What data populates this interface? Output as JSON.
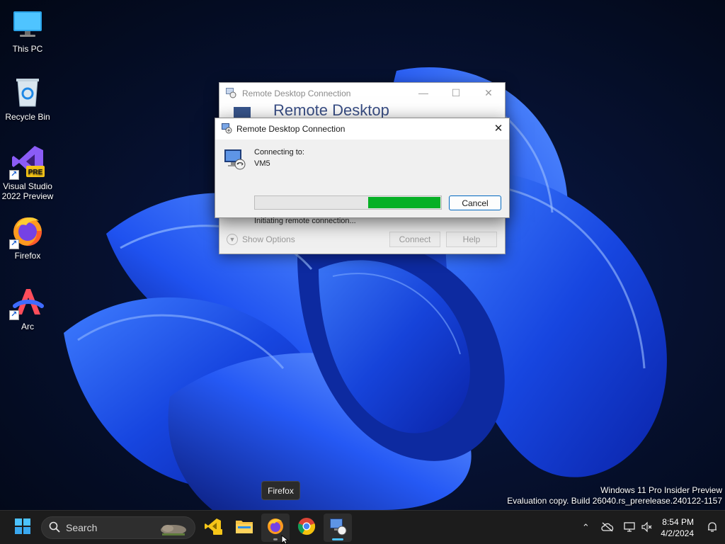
{
  "desktop": {
    "icons": [
      {
        "label": "This PC"
      },
      {
        "label": "Recycle Bin"
      },
      {
        "label": "Visual Studio 2022 Preview",
        "badge": "PRE"
      },
      {
        "label": "Firefox"
      },
      {
        "label": "Arc"
      }
    ]
  },
  "background_window": {
    "title": "Remote Desktop Connection",
    "banner_text": "Remote Desktop",
    "show_options": "Show Options",
    "connect_label": "Connect",
    "help_label": "Help"
  },
  "dialog": {
    "title": "Remote Desktop Connection",
    "connecting_to_label": "Connecting to:",
    "computer_name": "VM5",
    "status": "Initiating remote connection...",
    "cancel_label": "Cancel",
    "progress_filled_fraction": 0.39,
    "progress_color": "#06b025"
  },
  "tooltip": {
    "text": "Firefox"
  },
  "watermark": {
    "line1": "Windows 11 Pro Insider Preview",
    "line2": "Evaluation copy. Build 26040.rs_prerelease.240122-1157"
  },
  "taskbar": {
    "search_placeholder": "Search",
    "apps": [
      {
        "name": "Visual Studio 2022 Preview",
        "icon": "visual-studio-icon"
      },
      {
        "name": "File Explorer",
        "icon": "folder-icon"
      },
      {
        "name": "Firefox",
        "icon": "firefox-icon"
      },
      {
        "name": "Google Chrome",
        "icon": "chrome-icon"
      },
      {
        "name": "Remote Desktop Connection",
        "icon": "remote-desktop-icon",
        "active": true
      }
    ],
    "clock_time": "8:54 PM",
    "clock_date": "4/2/2024"
  },
  "colors": {
    "accent": "#0067c0",
    "active_indicator": "#4cc2ff",
    "taskbar_bg": "#1c1c1c"
  }
}
